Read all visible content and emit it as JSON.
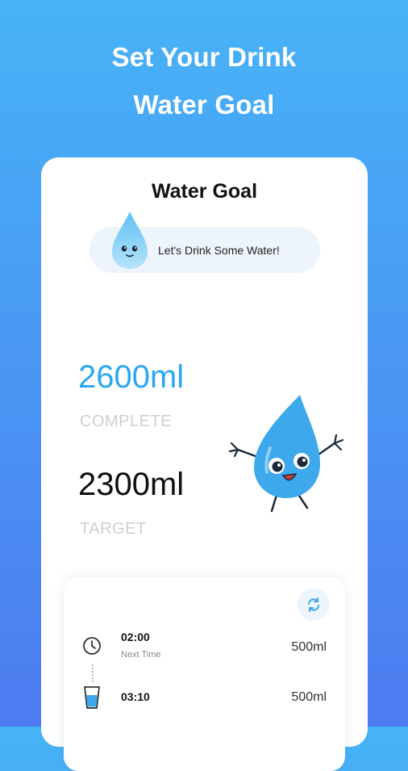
{
  "header": {
    "line1": "Set Your Drink",
    "line2": "Water Goal"
  },
  "card": {
    "title": "Water Goal",
    "speech": "Let's Drink Some Water!"
  },
  "stats": {
    "complete_value": "2600ml",
    "complete_label": "COMPLETE",
    "target_value": "2300ml",
    "target_label": "TARGET"
  },
  "schedule": {
    "items": [
      {
        "time": "02:00",
        "sub": "Next Time",
        "amount": "500ml",
        "icon": "clock-icon"
      },
      {
        "time": "03:10",
        "amount": "500ml",
        "icon": "water-glass-icon"
      }
    ]
  },
  "colors": {
    "accent": "#2aa8ef",
    "background_top": "#47b3f7",
    "background_bottom": "#4d7af0",
    "drop_blue": "#3ea8ec"
  }
}
